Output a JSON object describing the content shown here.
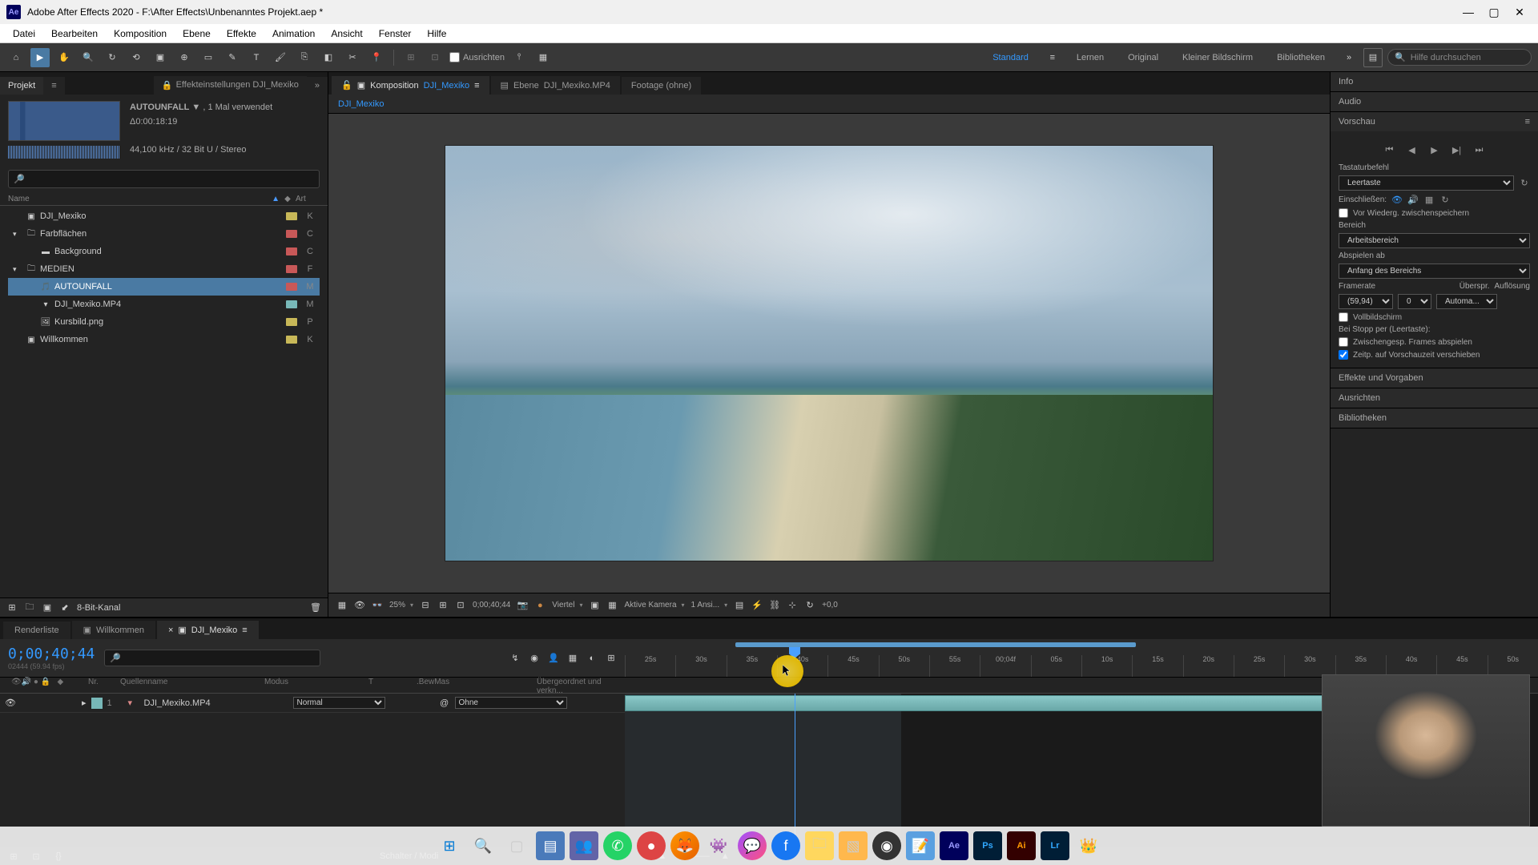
{
  "titlebar": {
    "app": "Adobe After Effects 2020",
    "path": "F:\\After Effects\\Unbenanntes Projekt.aep *"
  },
  "menu": [
    "Datei",
    "Bearbeiten",
    "Komposition",
    "Ebene",
    "Effekte",
    "Animation",
    "Ansicht",
    "Fenster",
    "Hilfe"
  ],
  "toolbar": {
    "ausrichten": "Ausrichten",
    "workspaces": {
      "active": "Standard",
      "others": [
        "Lernen",
        "Original",
        "Kleiner Bildschirm",
        "Bibliotheken"
      ]
    },
    "search_placeholder": "Hilfe durchsuchen"
  },
  "project": {
    "tab": "Projekt",
    "effect_tab": "Effekteinstellungen DJI_Mexiko",
    "selected_name": "AUTOUNFALL",
    "selected_caret": "▼",
    "use_count": ", 1 Mal verwendet",
    "duration": "Δ0:00:18:19",
    "audio_spec": "44,100 kHz / 32 Bit U / Stereo",
    "col_name": "Name",
    "col_art": "Art",
    "items": [
      {
        "icon": "comp",
        "name": "DJI_Mexiko",
        "color": "#c8b858",
        "art": "K",
        "indent": 0,
        "expand": ""
      },
      {
        "icon": "folder",
        "name": "Farbflächen",
        "color": "#c85858",
        "art": "C",
        "indent": 0,
        "expand": "▾"
      },
      {
        "icon": "solid",
        "name": "Background",
        "color": "#c85858",
        "art": "C",
        "indent": 1,
        "expand": ""
      },
      {
        "icon": "folder",
        "name": "MEDIEN",
        "color": "#c85858",
        "art": "F",
        "indent": 0,
        "expand": "▾"
      },
      {
        "icon": "audio",
        "name": "AUTOUNFALL",
        "color": "#c85858",
        "art": "M",
        "indent": 1,
        "expand": "",
        "selected": true
      },
      {
        "icon": "video",
        "name": "DJI_Mexiko.MP4",
        "color": "#78b8b8",
        "art": "M",
        "indent": 1,
        "expand": ""
      },
      {
        "icon": "image",
        "name": "Kursbild.png",
        "color": "#c8b858",
        "art": "P",
        "indent": 1,
        "expand": ""
      },
      {
        "icon": "comp",
        "name": "Willkommen",
        "color": "#c8b858",
        "art": "K",
        "indent": 0,
        "expand": ""
      }
    ],
    "footer_depth": "8-Bit-Kanal"
  },
  "comp_tabs": {
    "comp_pre": "Komposition",
    "comp_name": "DJI_Mexiko",
    "layer_pre": "Ebene",
    "layer_name": "DJI_Mexiko.MP4",
    "footage": "Footage  (ohne)"
  },
  "breadcrumb": "DJI_Mexiko",
  "viewer_controls": {
    "zoom": "25%",
    "timecode": "0;00;40;44",
    "resolution": "Viertel",
    "camera": "Aktive Kamera",
    "views": "1 Ansi...",
    "exposure": "+0,0"
  },
  "right": {
    "info": "Info",
    "audio": "Audio",
    "preview": "Vorschau",
    "shortcut_lbl": "Tastaturbefehl",
    "shortcut_val": "Leertaste",
    "include_lbl": "Einschließen:",
    "cache_lbl": "Vor Wiederg. zwischenspeichern",
    "range_lbl": "Bereich",
    "range_val": "Arbeitsbereich",
    "playfrom_lbl": "Abspielen ab",
    "playfrom_val": "Anfang des Bereichs",
    "framerate_lbl": "Framerate",
    "skip_lbl": "Überspr.",
    "res_lbl": "Auflösung",
    "framerate_val": "(59,94)",
    "skip_val": "0",
    "res_val": "Automa...",
    "fullscreen": "Vollbildschirm",
    "onstop_lbl": "Bei Stopp per (Leertaste):",
    "cached_frames": "Zwischengesp. Frames abspielen",
    "move_time": "Zeitp. auf Vorschauzeit verschieben",
    "effects": "Effekte und Vorgaben",
    "align": "Ausrichten",
    "libraries": "Bibliotheken"
  },
  "timeline": {
    "tabs": {
      "render": "Renderliste",
      "welcome": "Willkommen",
      "active": "DJI_Mexiko"
    },
    "time": "0;00;40;44",
    "frames_sub": "02444 (59.94 fps)",
    "ticks": [
      "25s",
      "30s",
      "35s",
      "40s",
      "45s",
      "50s",
      "55s",
      "00;04f",
      "05s",
      "10s",
      "15s",
      "20s",
      "25s",
      "30s",
      "35s",
      "40s",
      "45s",
      "50s"
    ],
    "cols": {
      "nr": "Nr.",
      "src": "Quellenname",
      "mod": "Modus",
      "t": "T",
      "bew": ".BewMas",
      "par": "Übergeordnet und verkn..."
    },
    "layer": {
      "num": "1",
      "name": "DJI_Mexiko.MP4",
      "mode": "Normal",
      "parent": "Ohne"
    },
    "footer": "Schalter / Modi"
  },
  "colors": {
    "accent": "#3399ff",
    "panel": "#232323",
    "dark": "#1a1a1a"
  }
}
